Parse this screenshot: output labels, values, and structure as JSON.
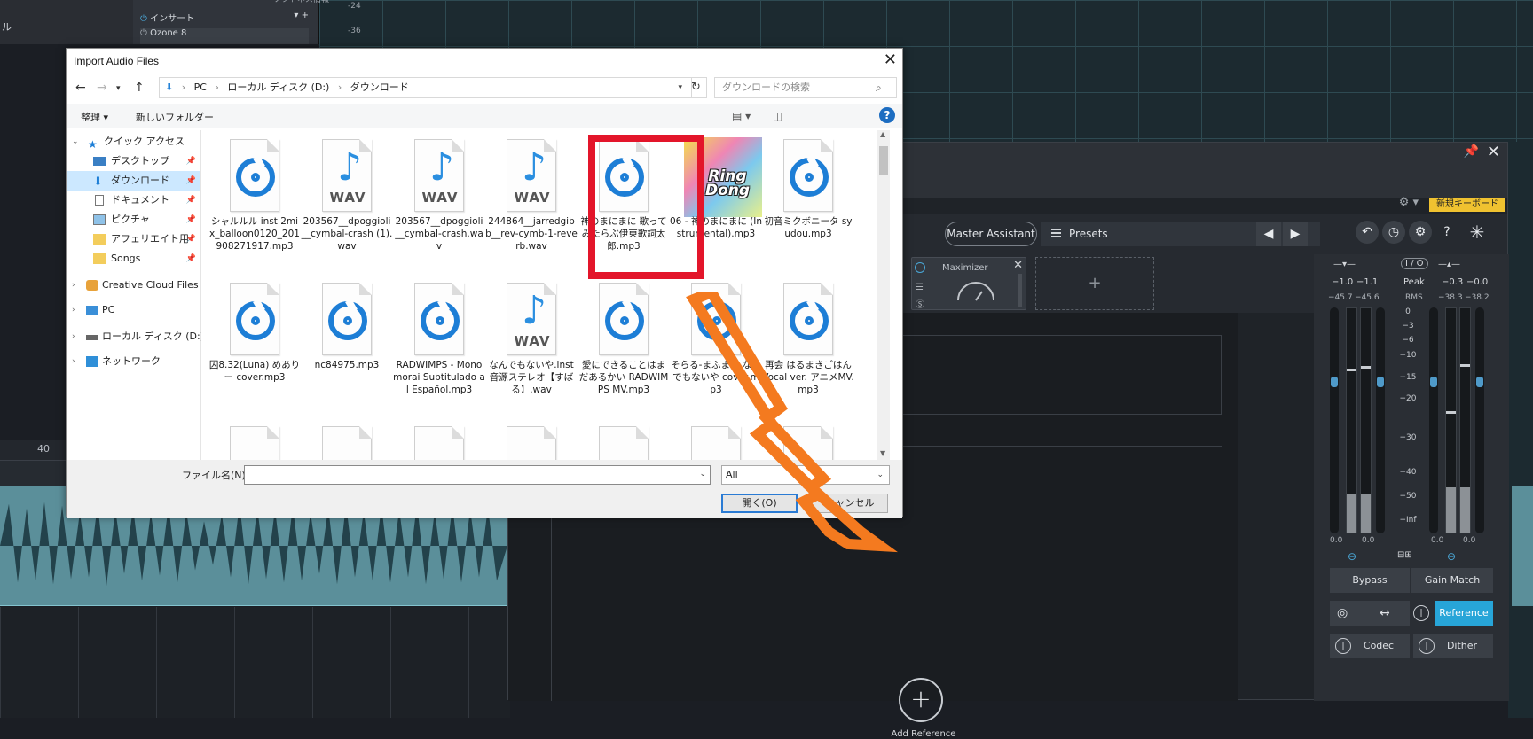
{
  "daw": {
    "insert_panel_title": "ソフトネス情報",
    "insert_label": "インサート",
    "insert_plugin": "Ozone 8",
    "left_label": "ル",
    "level_marks": [
      "-24",
      "-36"
    ],
    "ruler_marker": "40"
  },
  "ozone": {
    "keyboard_badge": "新規キーボード",
    "master_assistant": "Master Assistant",
    "presets": "Presets",
    "module_name": "Maximizer",
    "add_reference": "Add Reference",
    "meters": {
      "io_label": "I / O",
      "peak_label": "Peak",
      "rms_label": "RMS",
      "in_peak": [
        "−1.0",
        "−1.1"
      ],
      "in_rms": [
        "−45.7",
        "−45.6"
      ],
      "out_peak": [
        "−0.3",
        "−0.0"
      ],
      "out_rms": [
        "−38.3",
        "−38.2"
      ],
      "scale": [
        "0",
        "−3",
        "−6",
        "−10",
        "−15",
        "−20",
        "−30",
        "−40",
        "−50",
        "−Inf"
      ],
      "bottom_values": [
        "0.0",
        "0.0",
        "0.0",
        "0.0"
      ],
      "in_fill": [
        0.17,
        0.17
      ],
      "out_fill": [
        0.2,
        0.2
      ],
      "in_peak_pos": [
        0.72,
        0.73
      ],
      "out_peak_pos": [
        0.53,
        0.74
      ]
    },
    "buttons": {
      "bypass": "Bypass",
      "gain_match": "Gain Match",
      "reference": "Reference",
      "codec": "Codec",
      "dither": "Dither"
    }
  },
  "dialog": {
    "title": "Import Audio Files",
    "breadcrumb": [
      "PC",
      "ローカル ディスク (D:)",
      "ダウンロード"
    ],
    "search_placeholder": "ダウンロードの検索",
    "commands": {
      "organize": "整理 ▾",
      "new_folder": "新しいフォルダー"
    },
    "nav": [
      {
        "label": "クイック アクセス"
      },
      {
        "label": "デスクトップ"
      },
      {
        "label": "ダウンロード"
      },
      {
        "label": "ドキュメント"
      },
      {
        "label": "ピクチャ"
      },
      {
        "label": "アフェリエイト用"
      },
      {
        "label": "Songs"
      },
      {
        "label": "Creative Cloud Files"
      },
      {
        "label": "PC"
      },
      {
        "label": "ローカル ディスク (D:)"
      },
      {
        "label": "ネットワーク"
      }
    ],
    "files": [
      {
        "name": "シャルルル inst 2mix_balloon0120_201908271917.mp3",
        "type": "mp3"
      },
      {
        "name": "203567__dpoggioli__cymbal-crash (1).wav",
        "type": "wav"
      },
      {
        "name": "203567__dpoggioli__cymbal-crash.wav",
        "type": "wav"
      },
      {
        "name": "244864__jarredgibb__rev-cymb-1-reverb.wav",
        "type": "wav"
      },
      {
        "name": "神のまにまに 歌ってみたらぶ伊東歌詞太郎.mp3",
        "type": "mp3"
      },
      {
        "name": "06 - 神のまにまに (Instrumental).mp3",
        "type": "album",
        "album_text": "Ring Dong"
      },
      {
        "name": "初音ミクボニータ syudou.mp3",
        "type": "mp3"
      },
      {
        "name": "囚8.32(Luna) めありー cover.mp3",
        "type": "mp3"
      },
      {
        "name": "nc84975.mp3",
        "type": "mp3"
      },
      {
        "name": "RADWIMPS - Monomorai Subtitulado al Español.mp3",
        "type": "mp3"
      },
      {
        "name": "なんでもないや.inst 音源ステレオ【すばる】.wav",
        "type": "wav"
      },
      {
        "name": "愛にできることはまだあるかい RADWIMPS MV.mp3",
        "type": "mp3"
      },
      {
        "name": "そらる-まふまふ なんでもないや cover.mp3",
        "type": "mp3"
      },
      {
        "name": "再会 はるまきごはんVocal ver. アニメMV.mp3",
        "type": "mp3"
      }
    ],
    "filename_label": "ファイル名(N):",
    "filename_value": "",
    "filter_value": "All",
    "open_button": "開く(O)",
    "cancel_button": "キャンセル"
  },
  "colors": {
    "highlight": "#e3152a",
    "arrow": "#f47a1f",
    "accent_blue": "#27a5d8"
  }
}
